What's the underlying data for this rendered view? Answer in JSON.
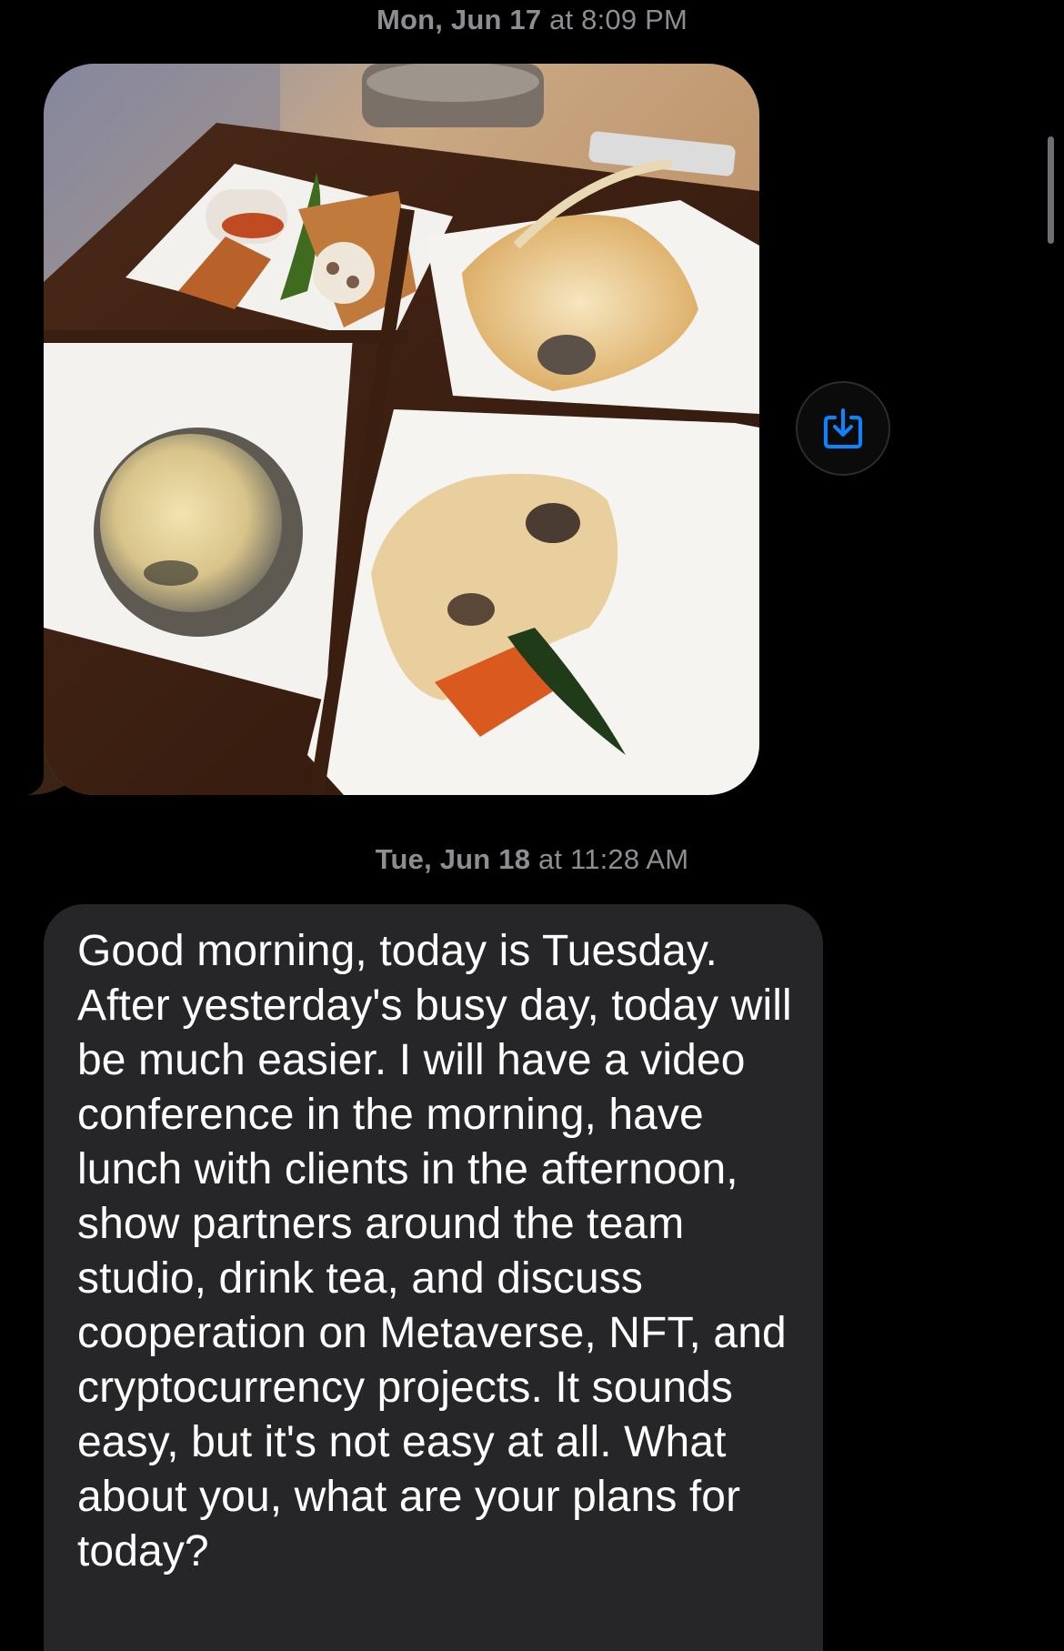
{
  "conversation": {
    "timestamps": [
      {
        "day": "Mon, Jun 17",
        "time": " at 8:09 PM"
      },
      {
        "day": "Tue, Jun 18",
        "time": " at 11:28 AM"
      }
    ],
    "messages": [
      {
        "type": "image",
        "icon": "food-photo",
        "action_icon": "save-download-icon"
      },
      {
        "type": "text",
        "text": "Good morning, today is Tuesday. After yesterday's busy day, today will be much easier. I will have a video conference in the morning, have lunch with clients in the afternoon, show partners around the team studio, drink tea, and discuss cooperation on Metaverse, NFT, and cryptocurrency projects. It sounds easy, but it's not easy at all. What about you, what are your plans for today?"
      }
    ]
  },
  "colors": {
    "background": "#000000",
    "bubble": "#262628",
    "timestamp": "#8d8d92",
    "accent": "#0a84ff"
  }
}
